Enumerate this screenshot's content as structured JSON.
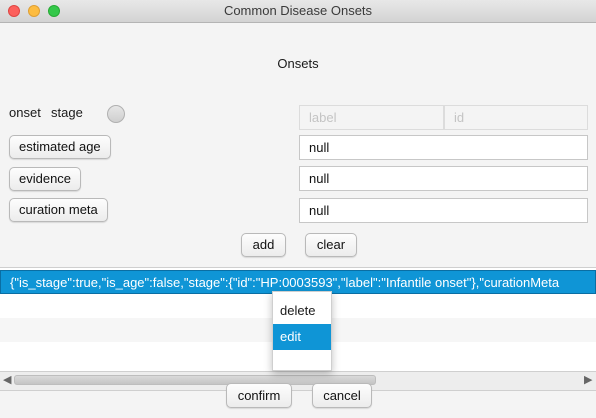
{
  "window": {
    "title": "Common Disease Onsets"
  },
  "heading": "Onsets",
  "form": {
    "onset_label": "onset",
    "stage_label": "stage",
    "stage_label_placeholder": "label",
    "stage_id_placeholder": "id",
    "estimated_age_button": "estimated age",
    "estimated_age_value": "null",
    "evidence_button": "evidence",
    "evidence_value": "null",
    "curation_meta_button": "curation meta",
    "curation_meta_value": "null"
  },
  "actions": {
    "add": "add",
    "clear": "clear"
  },
  "list": {
    "rows": [
      "{\"is_stage\":true,\"is_age\":false,\"stage\":{\"id\":\"HP:0003593\",\"label\":\"Infantile onset\"},\"curationMeta"
    ]
  },
  "context_menu": {
    "items": [
      "delete",
      "edit"
    ],
    "highlighted": "edit"
  },
  "footer": {
    "confirm": "confirm",
    "cancel": "cancel"
  },
  "colors": {
    "selection": "#0f95d6",
    "close": "#fc605c",
    "minimize": "#fdbc40",
    "zoom": "#34c84a"
  }
}
